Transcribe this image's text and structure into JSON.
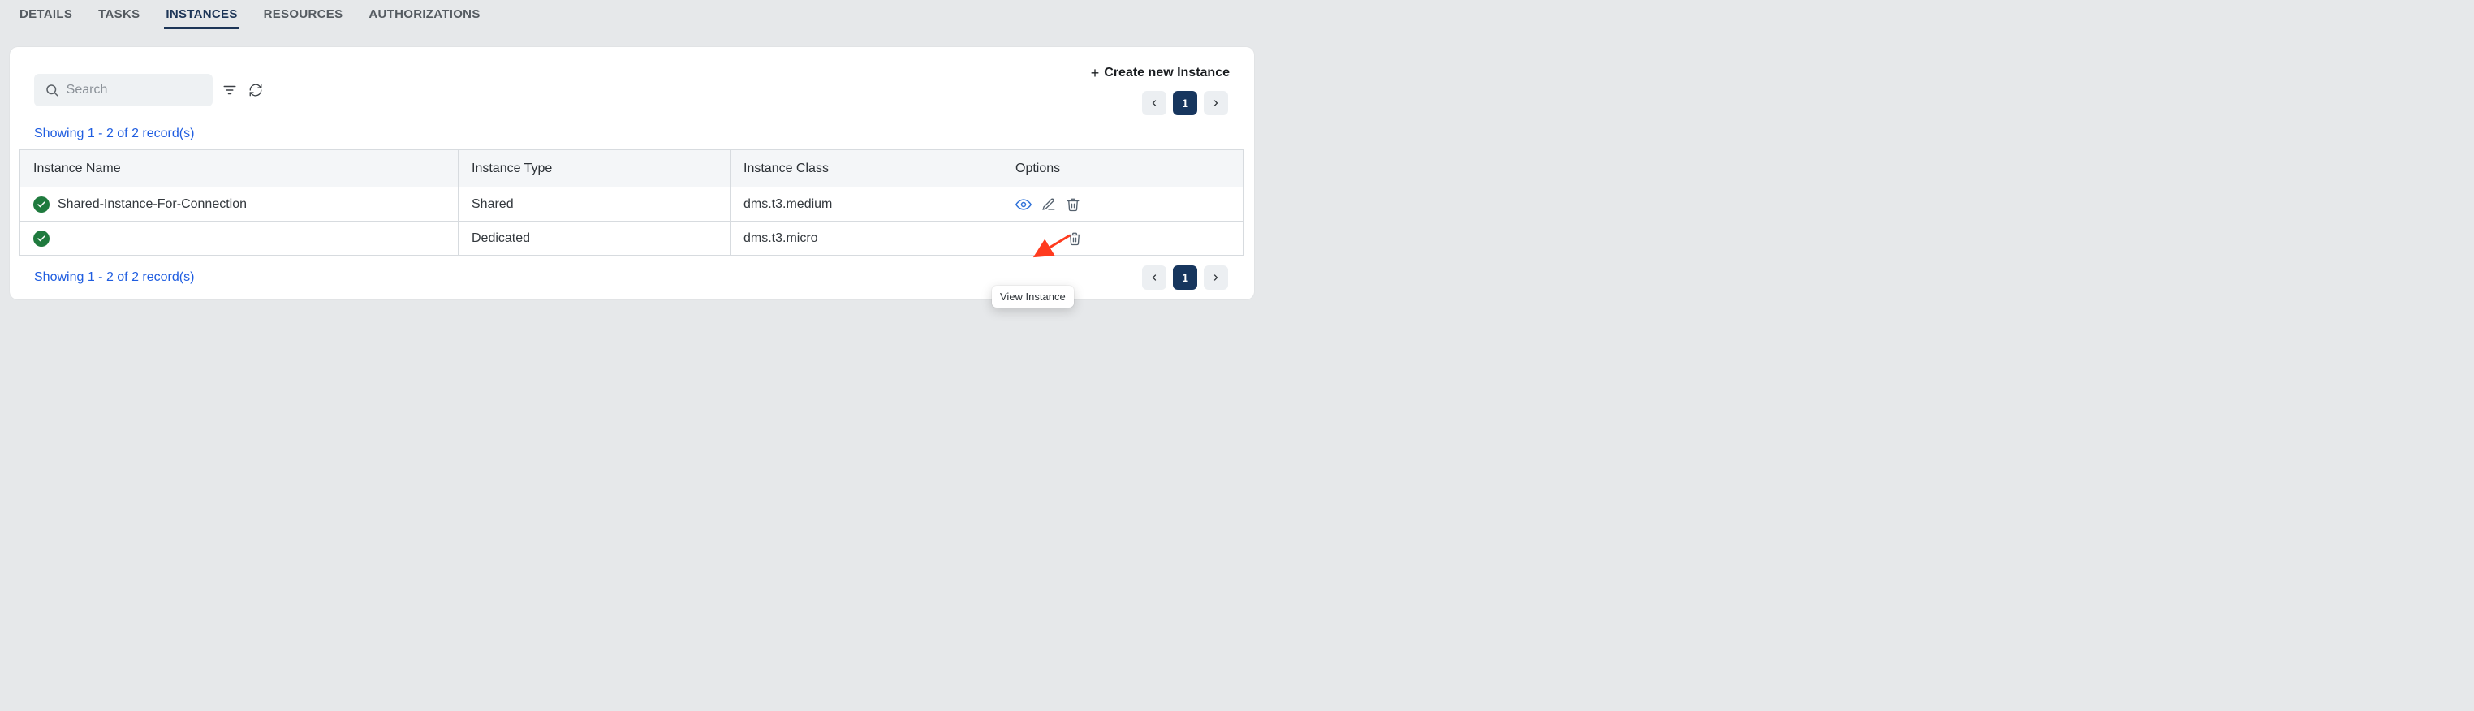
{
  "tabs": {
    "items": [
      {
        "label": "DETAILS"
      },
      {
        "label": "TASKS"
      },
      {
        "label": "INSTANCES",
        "active": true
      },
      {
        "label": "RESOURCES"
      },
      {
        "label": "AUTHORIZATIONS"
      }
    ]
  },
  "toolbar": {
    "search_placeholder": "Search",
    "create_label": "Create new Instance"
  },
  "records_summary": "Showing 1 - 2 of 2 record(s)",
  "pagination": {
    "current": "1"
  },
  "table": {
    "headers": {
      "name": "Instance Name",
      "type": "Instance Type",
      "class": "Instance Class",
      "options": "Options"
    },
    "rows": [
      {
        "name": "Shared-Instance-For-Connection",
        "type": "Shared",
        "class": "dms.t3.medium"
      },
      {
        "name": "",
        "type": "Dedicated",
        "class": "dms.t3.micro"
      }
    ]
  },
  "tooltip": {
    "view_instance": "View Instance"
  },
  "colors": {
    "accent": "#17365e",
    "link": "#1f5de0",
    "status_ok": "#1f7a3e"
  }
}
